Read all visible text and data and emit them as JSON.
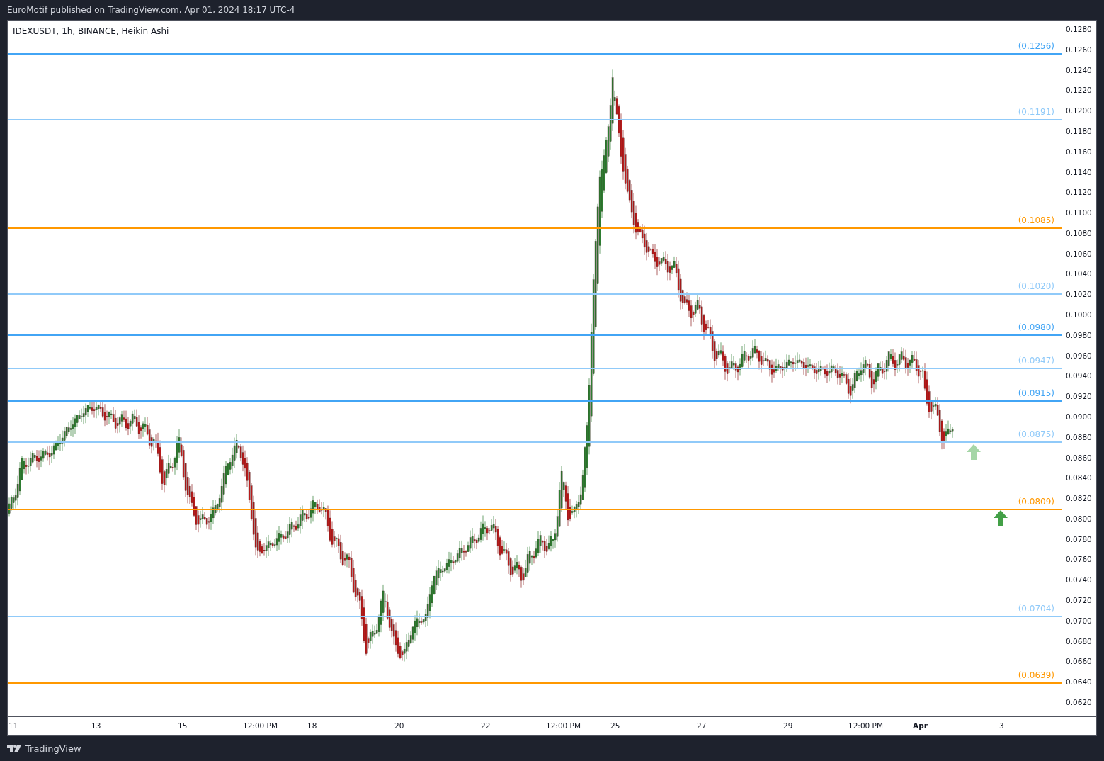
{
  "header": {
    "text": "EuroMotif published on TradingView.com, Apr 01, 2024 18:17 UTC-4"
  },
  "chart": {
    "legend": "IDEXUSDT, 1h, BINANCE, Heikin Ashi",
    "levels": [
      {
        "label": "(0.1256)",
        "color": "#42a5f5"
      },
      {
        "label": "(0.1191)",
        "color": "#90caf9"
      },
      {
        "label": "(0.1085)",
        "color": "#ff9800"
      },
      {
        "label": "(0.1020)",
        "color": "#90caf9"
      },
      {
        "label": "(0.0980)",
        "color": "#42a5f5"
      },
      {
        "label": "(0.0947)",
        "color": "#90caf9"
      },
      {
        "label": "(0.0915)",
        "color": "#42a5f5"
      },
      {
        "label": "(0.0875)",
        "color": "#90caf9"
      },
      {
        "label": "(0.0809)",
        "color": "#ff9800"
      },
      {
        "label": "(0.0704)",
        "color": "#90caf9"
      },
      {
        "label": "(0.0639)",
        "color": "#ff9800"
      }
    ],
    "markers": [
      {
        "color": "#a5d6a7"
      },
      {
        "color": "#43a047"
      }
    ],
    "price_ticks": [
      "0.1280",
      "0.1260",
      "0.1240",
      "0.1220",
      "0.1200",
      "0.1180",
      "0.1160",
      "0.1140",
      "0.1120",
      "0.1100",
      "0.1080",
      "0.1060",
      "0.1040",
      "0.1020",
      "0.1000",
      "0.0980",
      "0.0960",
      "0.0940",
      "0.0920",
      "0.0900",
      "0.0880",
      "0.0860",
      "0.0840",
      "0.0820",
      "0.0800",
      "0.0780",
      "0.0760",
      "0.0740",
      "0.0720",
      "0.0700",
      "0.0680",
      "0.0660",
      "0.0640",
      "0.0620"
    ],
    "time_ticks": [
      {
        "label": "11",
        "bold": false
      },
      {
        "label": "13",
        "bold": false
      },
      {
        "label": "15",
        "bold": false
      },
      {
        "label": "12:00 PM",
        "bold": false
      },
      {
        "label": "18",
        "bold": false
      },
      {
        "label": "20",
        "bold": false
      },
      {
        "label": "22",
        "bold": false
      },
      {
        "label": "12:00 PM",
        "bold": false
      },
      {
        "label": "25",
        "bold": false
      },
      {
        "label": "27",
        "bold": false
      },
      {
        "label": "29",
        "bold": false
      },
      {
        "label": "12:00 PM",
        "bold": false
      },
      {
        "label": "Apr",
        "bold": true
      },
      {
        "label": "3",
        "bold": false
      }
    ]
  },
  "footer": {
    "brand": "TradingView"
  }
}
